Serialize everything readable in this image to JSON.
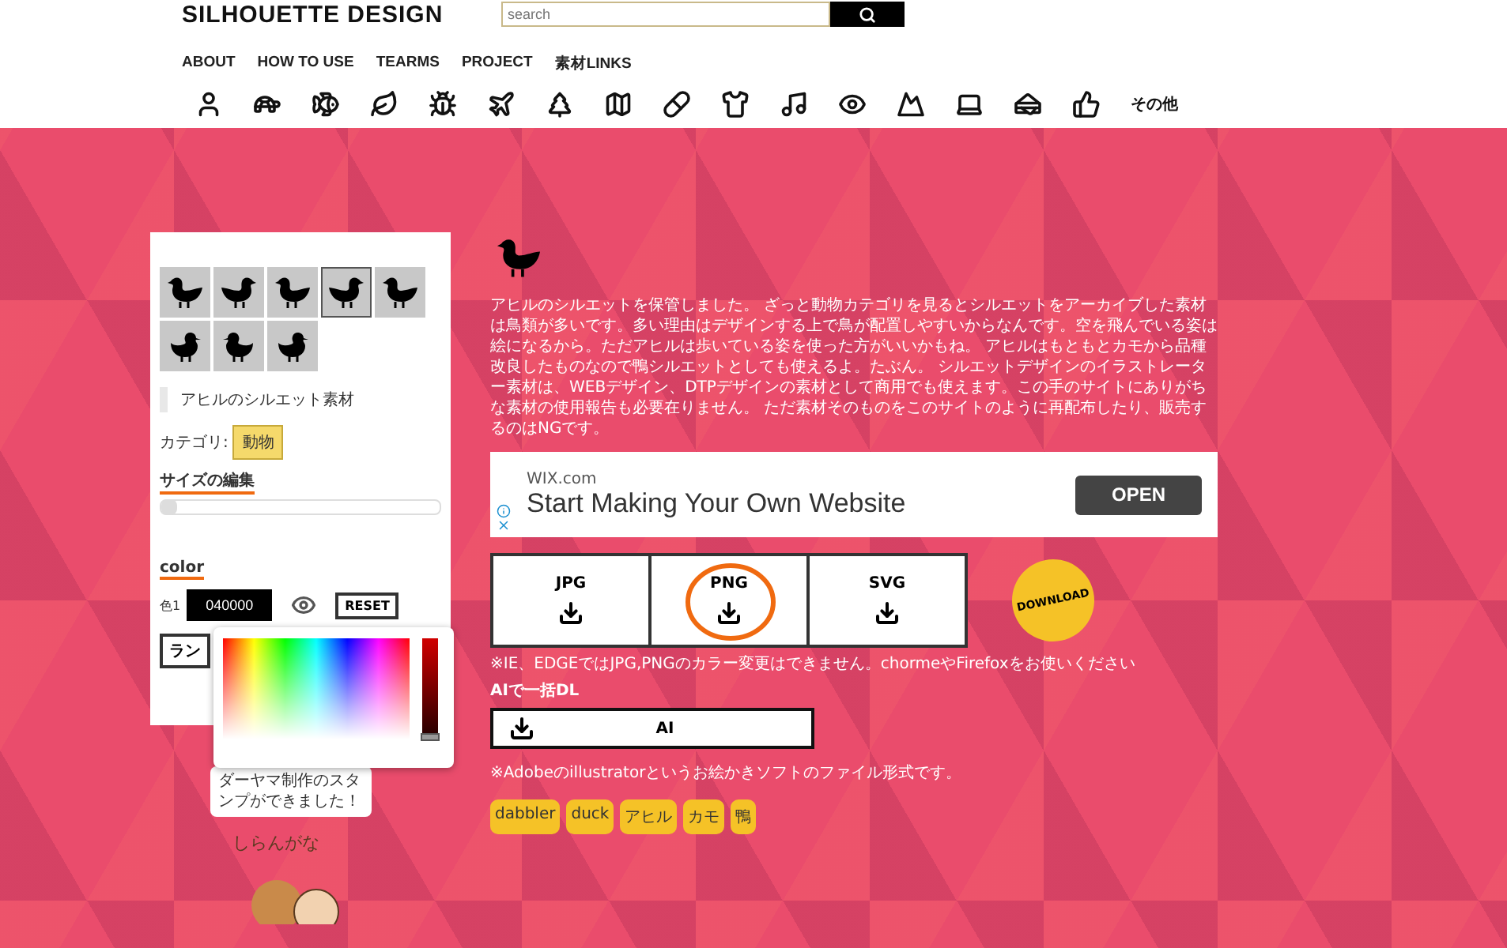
{
  "header": {
    "logo": "SILHOUETTE DESIGN",
    "search": {
      "placeholder": "search"
    },
    "nav": [
      "ABOUT",
      "HOW TO USE",
      "TEARMS",
      "PROJECT",
      "素材LINKS"
    ],
    "category_more": "その他"
  },
  "sidebar": {
    "thumbnails": [
      {
        "selected": false
      },
      {
        "selected": false
      },
      {
        "selected": false
      },
      {
        "selected": true
      },
      {
        "selected": false
      },
      {
        "selected": false
      },
      {
        "selected": false
      },
      {
        "selected": false
      }
    ],
    "title": "アヒルのシルエット素材",
    "category_label": "カテゴリ:",
    "category": "動物",
    "size_heading": "サイズの編集",
    "size": {
      "level": 0.0
    },
    "color_heading": "color",
    "color_label": "色1",
    "color_value": "040000",
    "reset": "RESET",
    "random": "ラン",
    "shade": {
      "level": 0.0
    }
  },
  "bubble": "ダーヤマ制作のスタンプができました！",
  "sticker_text": "しらんがな",
  "main": {
    "description": "アヒルのシルエットを保管しました。 ざっと動物カテゴリを見るとシルエットをアーカイブした素材は鳥類が多いです。多い理由はデザインする上で鳥が配置しやすいからなんです。空を飛んでいる姿は絵になるから。ただアヒルは歩いている姿を使った方がいいかもね。 アヒルはもともとカモから品種改良したものなので鴨シルエットとしても使えるよ。たぶん。 シルエットデザインのイラストレーター素材は、WEBデザイン、DTPデザインの素材として商用でも使えます。この手のサイトにありがちな素材の使用報告も必要在りません。 ただ素材そのものをこのサイトのように再配布したり、販売するのはNGです。",
    "ad": {
      "source": "WIX.com",
      "headline": "Start Making Your Own Website",
      "button": "OPEN"
    },
    "downloads": [
      {
        "label": "JPG",
        "circled": false
      },
      {
        "label": "PNG",
        "circled": true
      },
      {
        "label": "SVG",
        "circled": false
      }
    ],
    "download_badge": "DOWNLOAD",
    "browser_note": "※IE、EDGEではJPG,PNGのカラー変更はできません。chormeやFirefoxをお使いください",
    "ai_heading": "AIで一括DL",
    "ai_button": "AI",
    "ai_note": "※Adobeのillustratorというお絵かきソフトのファイル形式です。",
    "tags": [
      "dabbler",
      "duck",
      "アヒル",
      "カモ",
      "鴨"
    ]
  }
}
